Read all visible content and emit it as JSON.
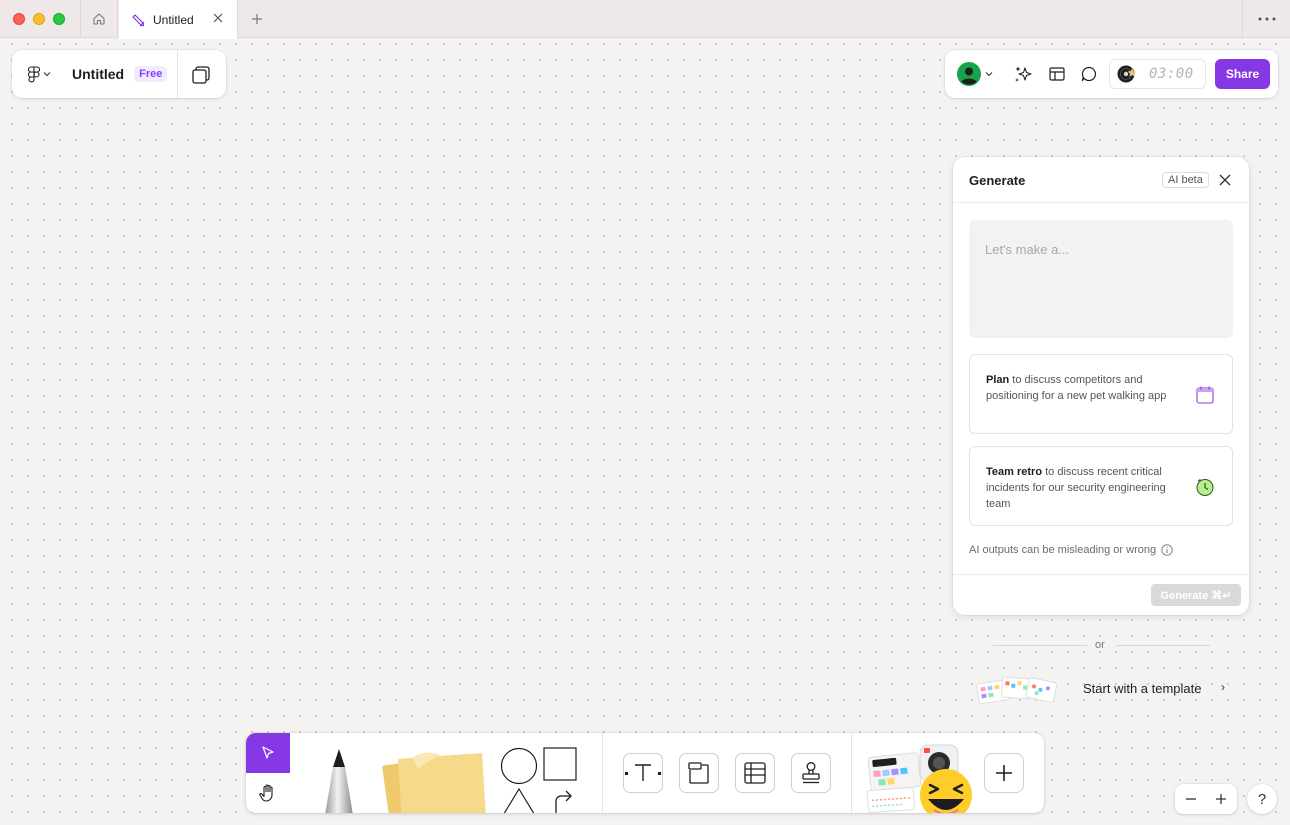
{
  "tabs": {
    "active_label": "Untitled"
  },
  "file": {
    "name": "Untitled",
    "plan_badge": "Free"
  },
  "toolbar": {
    "timer": "03:00",
    "share_label": "Share"
  },
  "generate": {
    "title": "Generate",
    "badge": "AI beta",
    "placeholder": "Let's make a...",
    "suggestions": [
      {
        "keyword": "Plan",
        "text": "to discuss competitors and positioning for a new pet walking app",
        "icon": "calendar-icon"
      },
      {
        "keyword": "Team retro",
        "text": "to discuss recent critical incidents for our security engineering team",
        "icon": "clock-icon"
      }
    ],
    "disclaimer": "AI outputs can be misleading or wrong",
    "button_label": "Generate ⌘↵"
  },
  "divider_text": "or",
  "template": {
    "label": "Start with a template",
    "chevron": "›"
  },
  "help_label": "?",
  "colors": {
    "accent": "#8638e5",
    "badge_bg": "#f1ebfe",
    "sticky": "#f7d98b"
  }
}
